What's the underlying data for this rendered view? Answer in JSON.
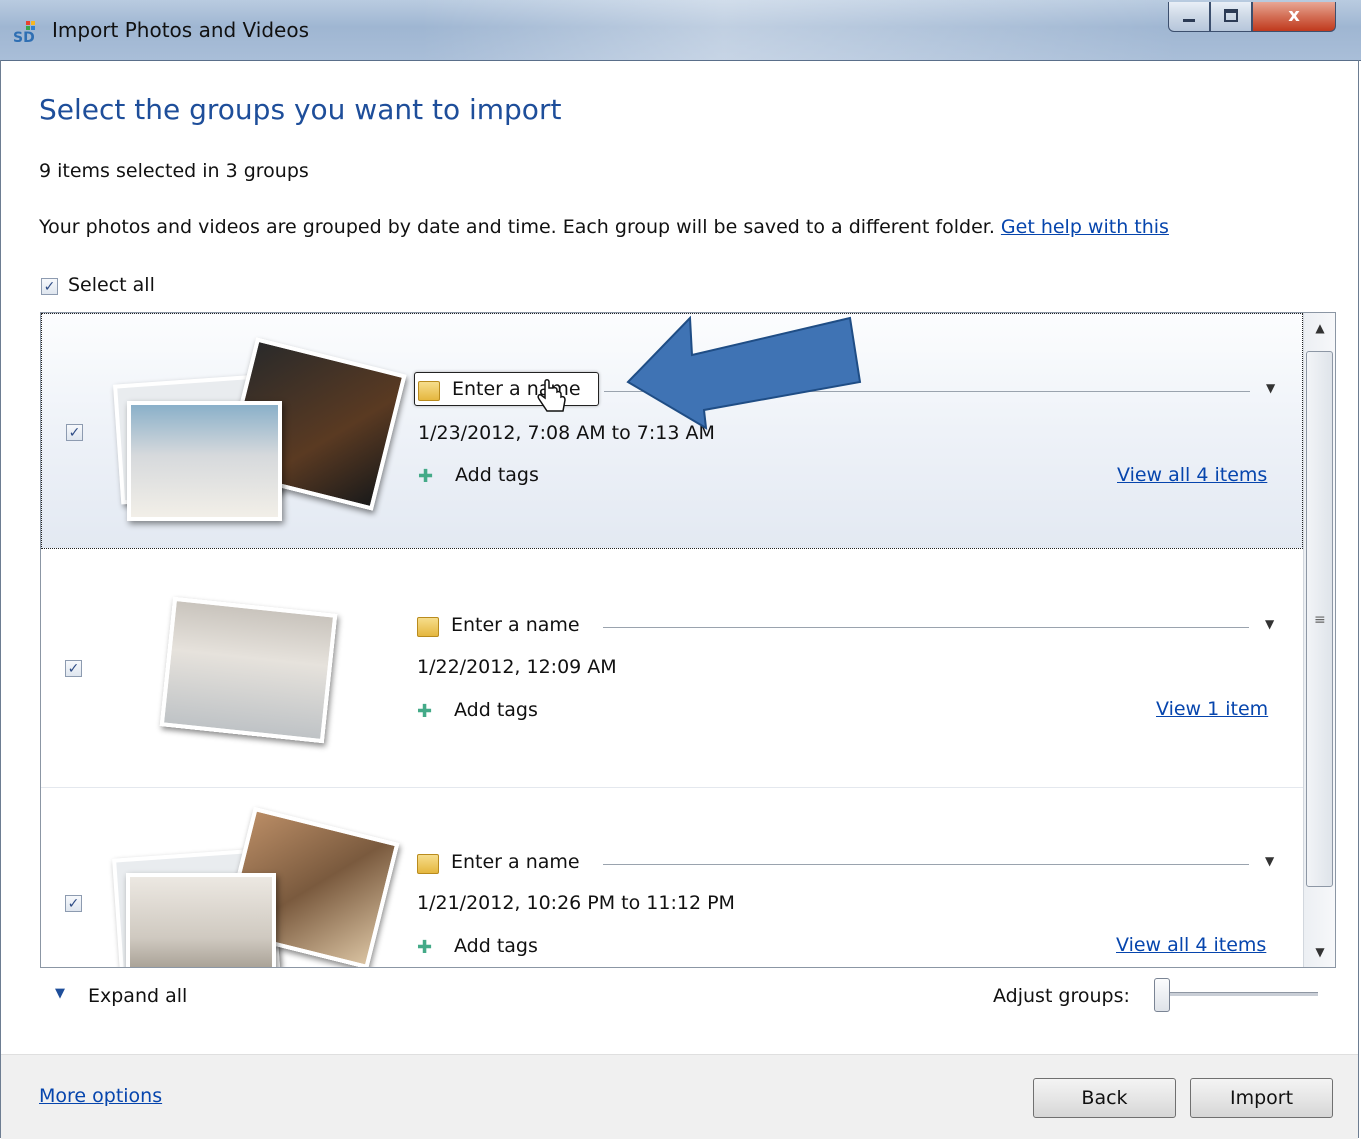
{
  "window": {
    "title": "Import Photos and Videos",
    "app_icon": "sd-card-icon",
    "controls": {
      "minimize": "minimize-icon",
      "maximize": "maximize-icon",
      "close": "x"
    }
  },
  "heading": "Select the groups you want to import",
  "selected_count": "9 items selected in 3 groups",
  "description": "Your photos and videos are grouped by date and time. Each group will be saved to a different folder.",
  "help_link": "Get help with this",
  "select_all": {
    "label": "Select all",
    "checked": true
  },
  "groups": [
    {
      "checked": true,
      "name_placeholder": "Enter a name",
      "date": "1/23/2012, 7:08 AM to 7:13 AM",
      "tags_label": "Add tags",
      "view_link": "View all 4 items",
      "selected": true
    },
    {
      "checked": true,
      "name_placeholder": "Enter a name",
      "date": "1/22/2012, 12:09 AM",
      "tags_label": "Add tags",
      "view_link": "View 1 item",
      "selected": false
    },
    {
      "checked": true,
      "name_placeholder": "Enter a name",
      "date": "1/21/2012, 10:26 PM to 11:12 PM",
      "tags_label": "Add tags",
      "view_link": "View all 4 items",
      "selected": false
    }
  ],
  "footer": {
    "expand_all": "Expand all",
    "adjust_groups": "Adjust groups:",
    "adjust_groups_level": 0,
    "more_options": "More options",
    "back": "Back",
    "import": "Import"
  },
  "checkmark": "✓",
  "colors": {
    "heading": "#1e4e9a",
    "link": "#0645ad",
    "annotation_arrow": "#3f73b4"
  }
}
